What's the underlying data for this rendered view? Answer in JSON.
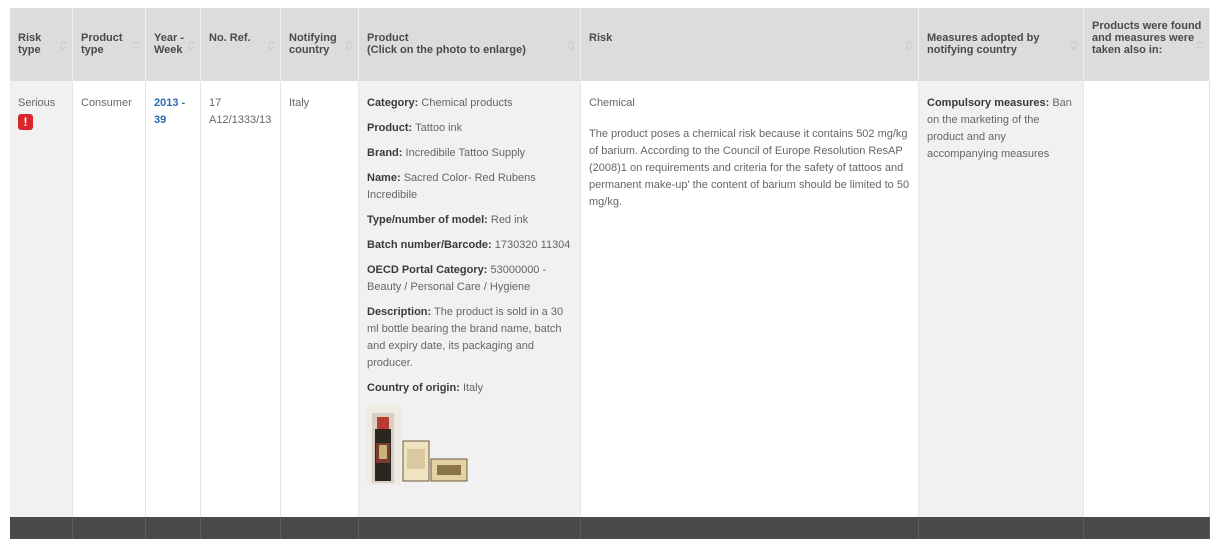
{
  "headers": {
    "risk_type": "Risk type",
    "product_type": "Product type",
    "year_week": "Year - Week",
    "no_ref": "No. Ref.",
    "notifying_country": "Notifying country",
    "product": "Product",
    "product_sub": "(Click on the photo to enlarge)",
    "risk": "Risk",
    "measures": "Measures adopted by notifying country",
    "also_in": "Products were found and measures were taken also in:"
  },
  "row": {
    "risk_type": "Serious",
    "risk_icon": "!",
    "product_type": "Consumer",
    "year_week": "2013 - 39",
    "no_ref_1": "17",
    "no_ref_2": "A12/1333/13",
    "notifying_country": "Italy",
    "product": {
      "category_label": "Category:",
      "category": "Chemical products",
      "product_label": "Product:",
      "product": "Tattoo ink",
      "brand_label": "Brand:",
      "brand": "Incredibile Tattoo Supply",
      "name_label": "Name:",
      "name": "Sacred Color- Red Rubens Incredibile",
      "model_label": "Type/number of model:",
      "model": "Red ink",
      "batch_label": "Batch number/Barcode:",
      "batch": "1730320 11304",
      "oecd_label": "OECD Portal Category:",
      "oecd": "53000000 - Beauty / Personal Care / Hygiene",
      "desc_label": "Description:",
      "desc": "The product is sold in a 30 ml bottle bearing the brand name, batch and expiry date, its packaging and producer.",
      "origin_label": "Country of origin:",
      "origin": "Italy"
    },
    "risk_title": "Chemical",
    "risk_desc": "The product poses a chemical risk because it contains 502 mg/kg of barium. According to the Council of Europe Resolution ResAP (2008)1 on requirements and criteria for the safety of tattoos and permanent make-up' the content of barium should be limited to 50 mg/kg.",
    "measures_label": "Compulsory measures:",
    "measures": "Ban on the marketing of the product and any accompanying measures",
    "also_in": ""
  },
  "colors": {
    "header_bg": "#dcdcdc",
    "shade_bg": "#f1f1f1",
    "footer_bg": "#4a4a4a",
    "link_blue": "#2a6ab5",
    "risk_red": "#d9262d"
  }
}
